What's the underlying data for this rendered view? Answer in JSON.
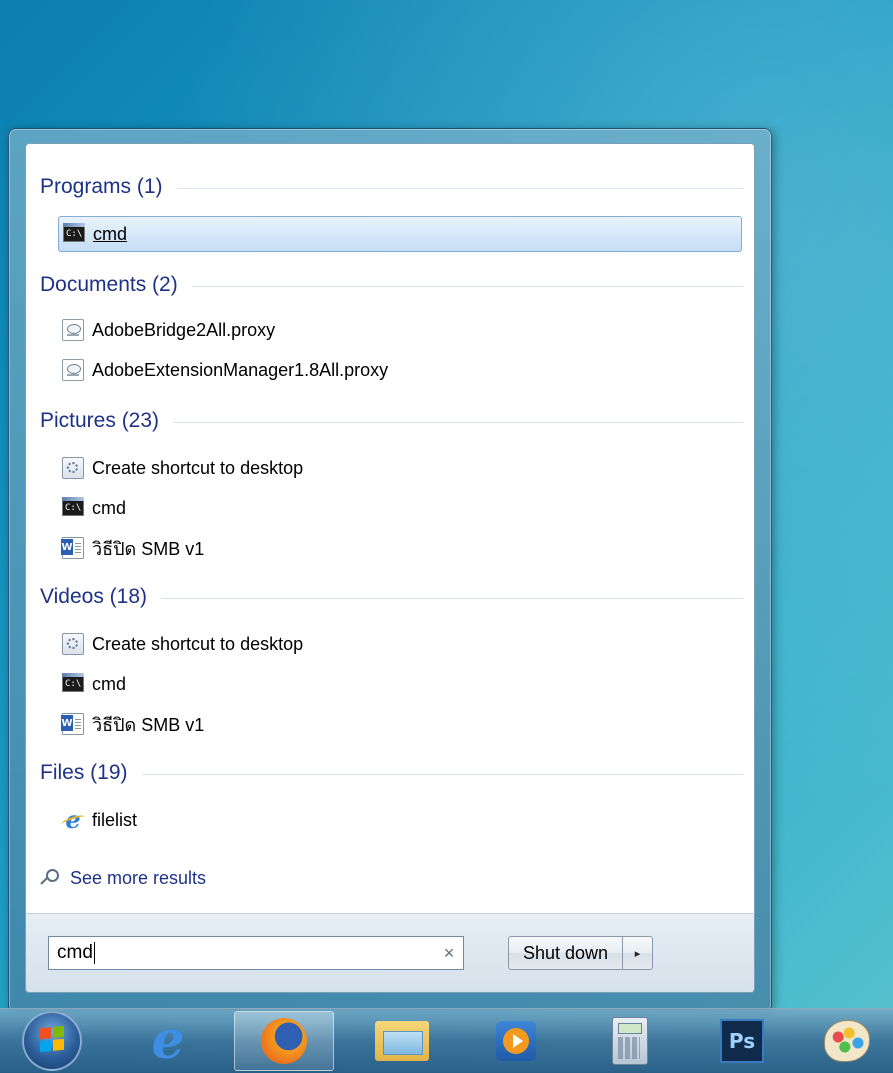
{
  "search": {
    "query": "cmd",
    "clear_symbol": "×"
  },
  "shutdown": {
    "label": "Shut down",
    "arrow": "▸"
  },
  "see_more": "See more results",
  "groups": [
    {
      "title": "Programs (1)",
      "items": [
        {
          "label": "cmd",
          "icon": "cmd-icon"
        }
      ]
    },
    {
      "title": "Documents (2)",
      "items": [
        {
          "label": "AdobeBridge2All.proxy",
          "icon": "proxy-file-icon"
        },
        {
          "label": "AdobeExtensionManager1.8All.proxy",
          "icon": "proxy-file-icon"
        }
      ]
    },
    {
      "title": "Pictures (23)",
      "items": [
        {
          "label": "Create shortcut to desktop",
          "icon": "shortcut-icon"
        },
        {
          "label": "cmd",
          "icon": "cmd-icon"
        },
        {
          "label": "วิธีปิด SMB v1",
          "icon": "word-doc-icon"
        }
      ]
    },
    {
      "title": "Videos (18)",
      "items": [
        {
          "label": "Create shortcut to desktop",
          "icon": "shortcut-icon"
        },
        {
          "label": "cmd",
          "icon": "cmd-icon"
        },
        {
          "label": "วิธีปิด SMB v1",
          "icon": "word-doc-icon"
        }
      ]
    },
    {
      "title": "Files (19)",
      "items": [
        {
          "label": "filelist",
          "icon": "ie-document-icon"
        }
      ]
    }
  ],
  "taskbar": {
    "items": [
      "start-orb",
      "internet-explorer-icon",
      "firefox-icon",
      "file-explorer-icon",
      "media-player-icon",
      "calculator-icon",
      "photoshop-icon",
      "paint-icon"
    ],
    "photoshop_label": "Ps",
    "ie_glyph": "e"
  },
  "cmd_icon_text": "C:\\",
  "colors": {
    "group_title": "#1e3287",
    "selection_border": "#84acd6",
    "desktop": "#1d9cc4"
  }
}
